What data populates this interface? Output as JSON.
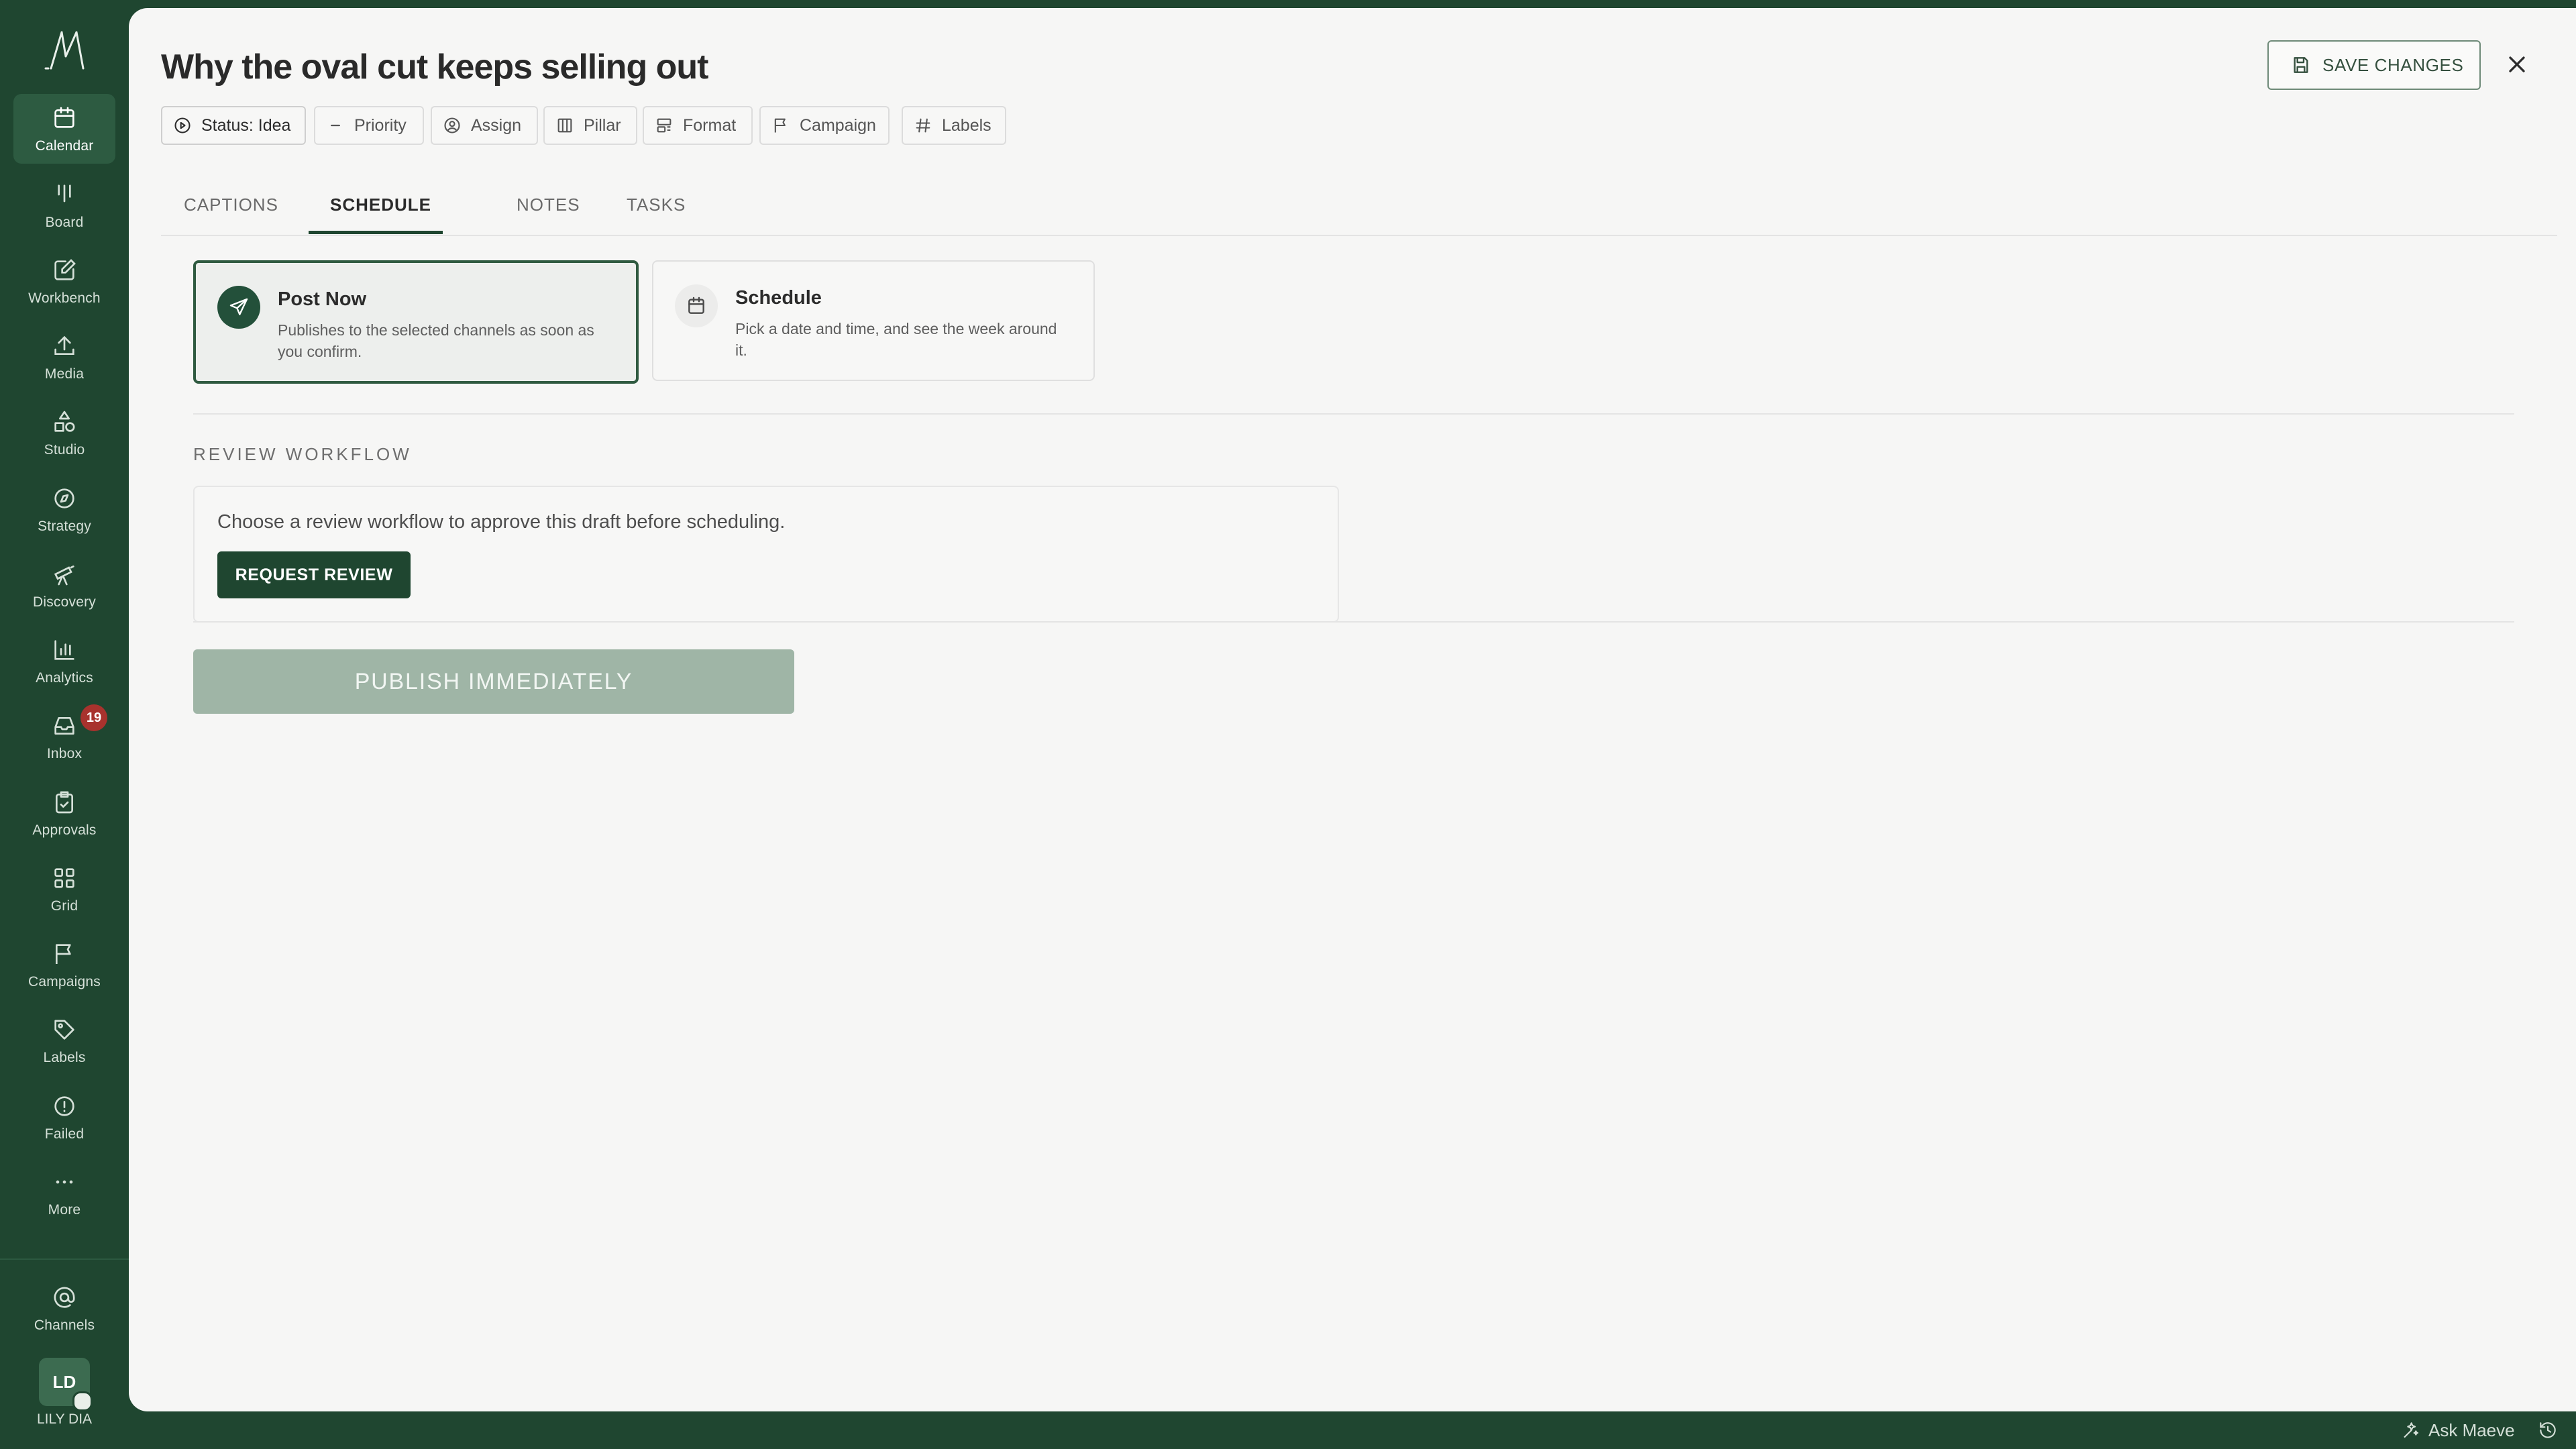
{
  "sidebar": {
    "logo": "/\\/\\",
    "items": [
      {
        "label": "Calendar",
        "icon": "calendar-icon",
        "active": true
      },
      {
        "label": "Board",
        "icon": "board-icon"
      },
      {
        "label": "Workbench",
        "icon": "workbench-icon"
      },
      {
        "label": "Media",
        "icon": "upload-icon"
      },
      {
        "label": "Studio",
        "icon": "shapes-icon"
      },
      {
        "label": "Strategy",
        "icon": "compass-icon"
      },
      {
        "label": "Discovery",
        "icon": "telescope-icon"
      },
      {
        "label": "Analytics",
        "icon": "bar-chart-icon"
      },
      {
        "label": "Inbox",
        "icon": "inbox-icon",
        "badge": "19"
      },
      {
        "label": "Approvals",
        "icon": "clipboard-check-icon"
      },
      {
        "label": "Grid",
        "icon": "grid-icon"
      },
      {
        "label": "Campaigns",
        "icon": "flag-icon"
      },
      {
        "label": "Labels",
        "icon": "tag-icon"
      },
      {
        "label": "Failed",
        "icon": "alert-circle-icon"
      },
      {
        "label": "More",
        "icon": "more-icon"
      }
    ],
    "channels": {
      "label": "Channels",
      "icon": "at-sign-icon"
    },
    "user": {
      "initials": "LD",
      "name": "LILY DIA"
    }
  },
  "header": {
    "title": "Why the oval cut keeps selling out",
    "save_label": "SAVE CHANGES",
    "chips": [
      "Status: Idea",
      "Priority",
      "Assign",
      "Pillar",
      "Format",
      "Campaign",
      "Labels"
    ]
  },
  "tabs": [
    {
      "label": "CAPTIONS"
    },
    {
      "label": "SCHEDULE",
      "active": true
    },
    {
      "label": "NOTES"
    },
    {
      "label": "TASKS"
    }
  ],
  "options": {
    "post_now": {
      "title": "Post Now",
      "desc": "Publishes to the selected channels as soon as you confirm.",
      "selected": true
    },
    "schedule": {
      "title": "Schedule",
      "desc": "Pick a date and time, and see the week around it."
    }
  },
  "review": {
    "section_label": "REVIEW WORKFLOW",
    "text": "Choose a review workflow to approve this draft before scheduling.",
    "button": "REQUEST REVIEW"
  },
  "publish_label": "PUBLISH IMMEDIATELY",
  "footer": {
    "ask_label": "Ask Maeve"
  },
  "colors": {
    "brand": "#1f4630",
    "accent_active": "#2d5b41",
    "badge": "#a8322d",
    "publish_disabled": "#9fb5a6"
  }
}
